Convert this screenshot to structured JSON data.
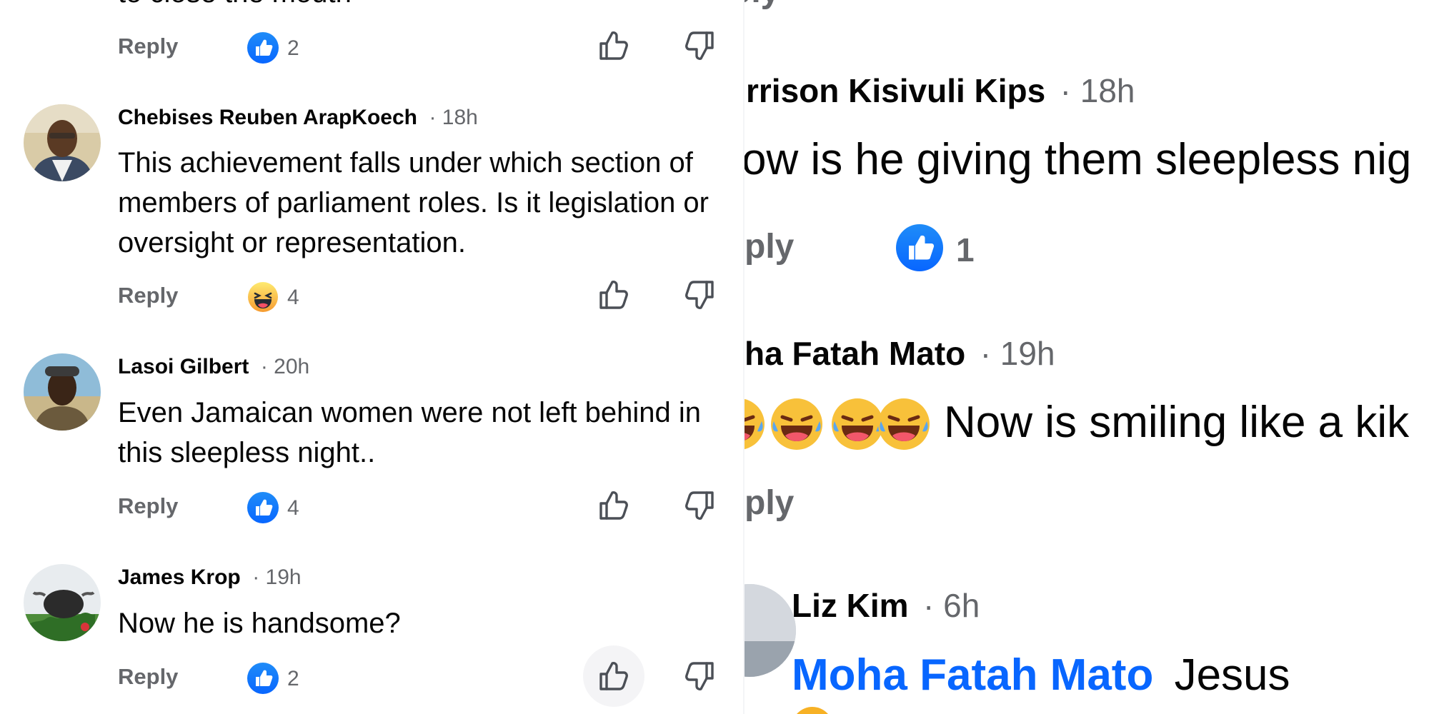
{
  "left": {
    "top_fragment": {
      "partial_text": "to close the mouth",
      "reply_label": "Reply",
      "reaction": "like",
      "count": "2"
    },
    "comments": [
      {
        "author": "Chebises Reuben ArapKoech",
        "time": "· 18h",
        "text": "This achievement falls under which section of members of parliament roles. Is it legislation or oversight or representation.",
        "reply_label": "Reply",
        "reaction": "haha",
        "count": "4"
      },
      {
        "author": "Lasoi Gilbert",
        "time": "· 20h",
        "text": "Even Jamaican women were not left behind in this sleepless night..",
        "reply_label": "Reply",
        "reaction": "like",
        "count": "4"
      },
      {
        "author": "James Krop",
        "time": "· 19h",
        "text": "Now he is handsome?",
        "reply_label": "Reply",
        "reaction": "like",
        "count": "2"
      }
    ]
  },
  "right": {
    "top_fragment": "ply",
    "comments": [
      {
        "author": "rrison Kisivuli Kips",
        "time": "· 18h",
        "text": "ow is he giving them sleepless nig",
        "reply_label": "ply",
        "reaction": "like",
        "count": "1"
      },
      {
        "author": "ha Fatah Mato",
        "time": "· 19h",
        "emojis": "😂😂😂",
        "text": "Now is smiling like a kik",
        "reply_label": "ply"
      },
      {
        "author": "Liz Kim",
        "time": "· 6h",
        "mention": "Moha Fatah Mato",
        "text": "Jesus"
      }
    ]
  },
  "icons": {
    "like": "thumbs-up",
    "dislike": "thumbs-down",
    "haha": "laughing-face",
    "tears": "tears-of-joy-face"
  },
  "colors": {
    "text": "#050505",
    "secondary_text": "#65676b",
    "like_blue": "#0866ff",
    "mention_blue": "#0866ff",
    "emoji_yellow": "#f7b125"
  }
}
